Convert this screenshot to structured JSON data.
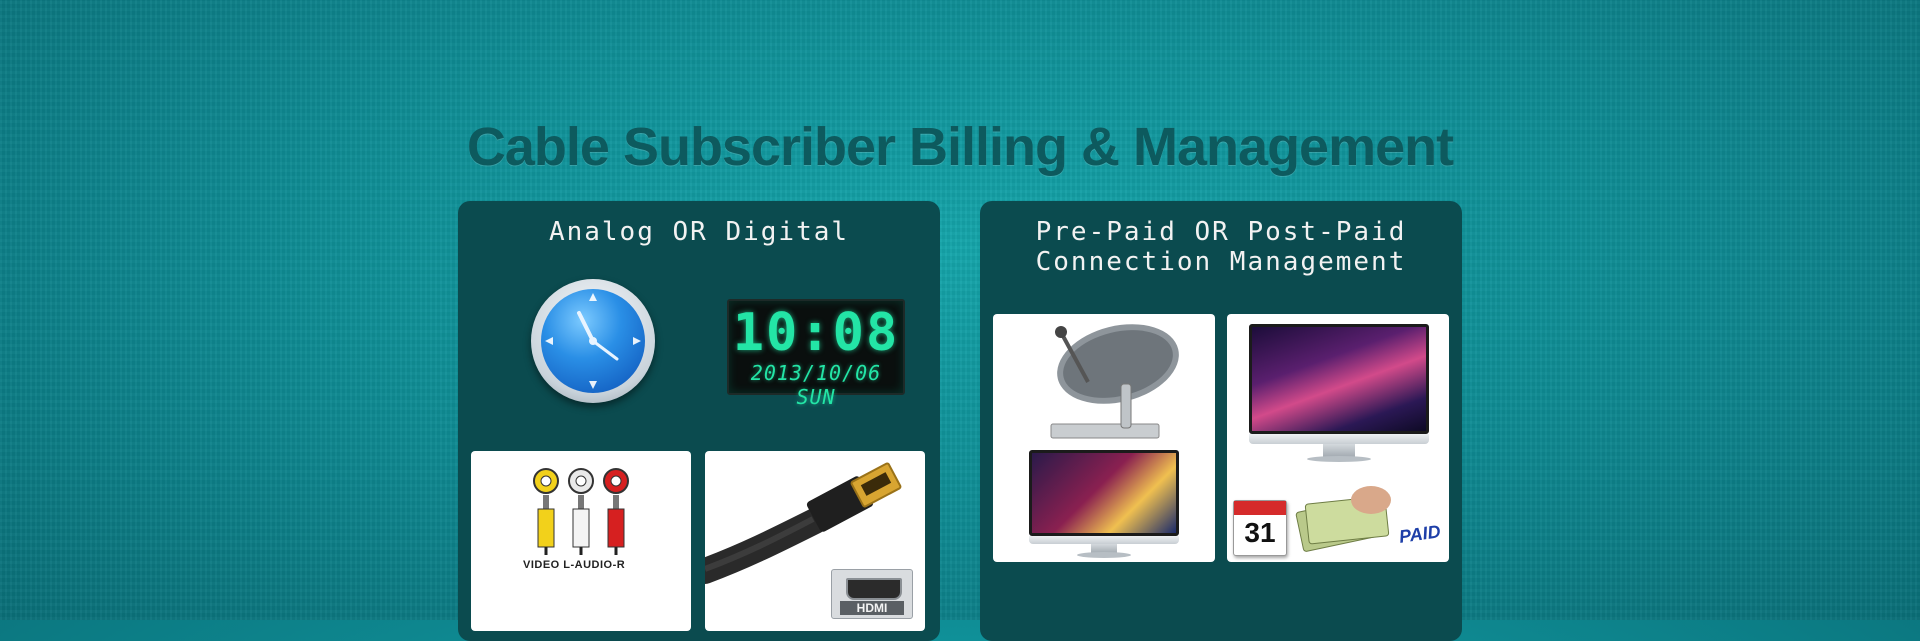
{
  "hero": {
    "title": "Cable Subscriber Billing & Management"
  },
  "left_panel": {
    "heading": "Analog OR Digital",
    "digital_clock": {
      "time": "10:08",
      "date": "2013/10/06 SUN"
    },
    "rca_card": {
      "labels": "VIDEO L-AUDIO-R"
    },
    "hdmi_card": {
      "badge_label": "HDMI"
    }
  },
  "right_panel": {
    "heading_line1": "Pre-Paid OR Post-Paid",
    "heading_line2": "Connection Management",
    "billing_card": {
      "calendar_day": "31",
      "stamp": "PAID"
    }
  },
  "colors": {
    "background": "#0f8f97",
    "title": "#0d5a5e",
    "panel": "#0b4b4f",
    "digital_led": "#23e5a6"
  }
}
